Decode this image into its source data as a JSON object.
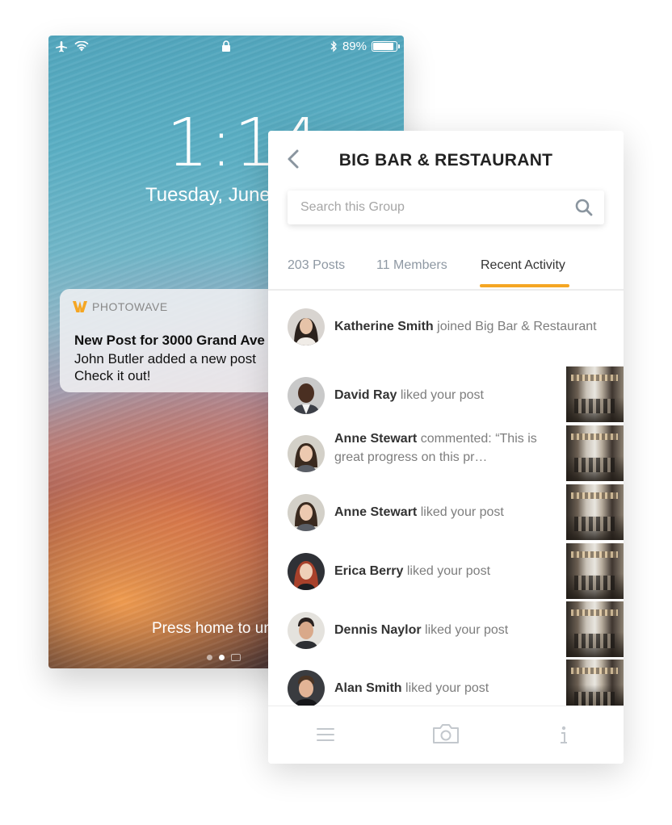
{
  "lock_screen": {
    "status_bar": {
      "battery": "89%",
      "battery_level": 0.89
    },
    "time": "1:14",
    "date": "Tuesday, June",
    "notification": {
      "app_name": "PHOTOWAVE",
      "title": "New Post for 3000 Grand Ave",
      "body_line1": "John Butler added a new post",
      "body_line2": "Check it out!"
    },
    "unlock_hint": "Press home to unlock"
  },
  "app": {
    "title": "BIG BAR & RESTAURANT",
    "search": {
      "placeholder": "Search this Group"
    },
    "tabs": [
      {
        "label": "203 Posts"
      },
      {
        "label": "11 Members"
      },
      {
        "label": "Recent Activity",
        "active": true
      }
    ],
    "activity": [
      {
        "name": "Katherine Smith",
        "action": "joined Big Bar & Restaurant"
      },
      {
        "name": "David Ray",
        "action": "liked your post"
      },
      {
        "name": "Anne Stewart",
        "action": "commented: “This is great progress on this pr…"
      },
      {
        "name": "Anne Stewart",
        "action": "liked your post"
      },
      {
        "name": "Erica Berry",
        "action": "liked your post"
      },
      {
        "name": "Dennis Naylor",
        "action": "liked your post"
      },
      {
        "name": "Alan Smith",
        "action": "liked your post"
      }
    ]
  },
  "colors": {
    "accent": "#f5a623",
    "title": "#222222",
    "muted": "#8e98a3"
  },
  "icons": [
    "airplane-icon",
    "wifi-icon",
    "lock-icon",
    "bluetooth-icon",
    "back-chevron-icon",
    "search-icon",
    "menu-icon",
    "camera-icon",
    "info-icon"
  ]
}
